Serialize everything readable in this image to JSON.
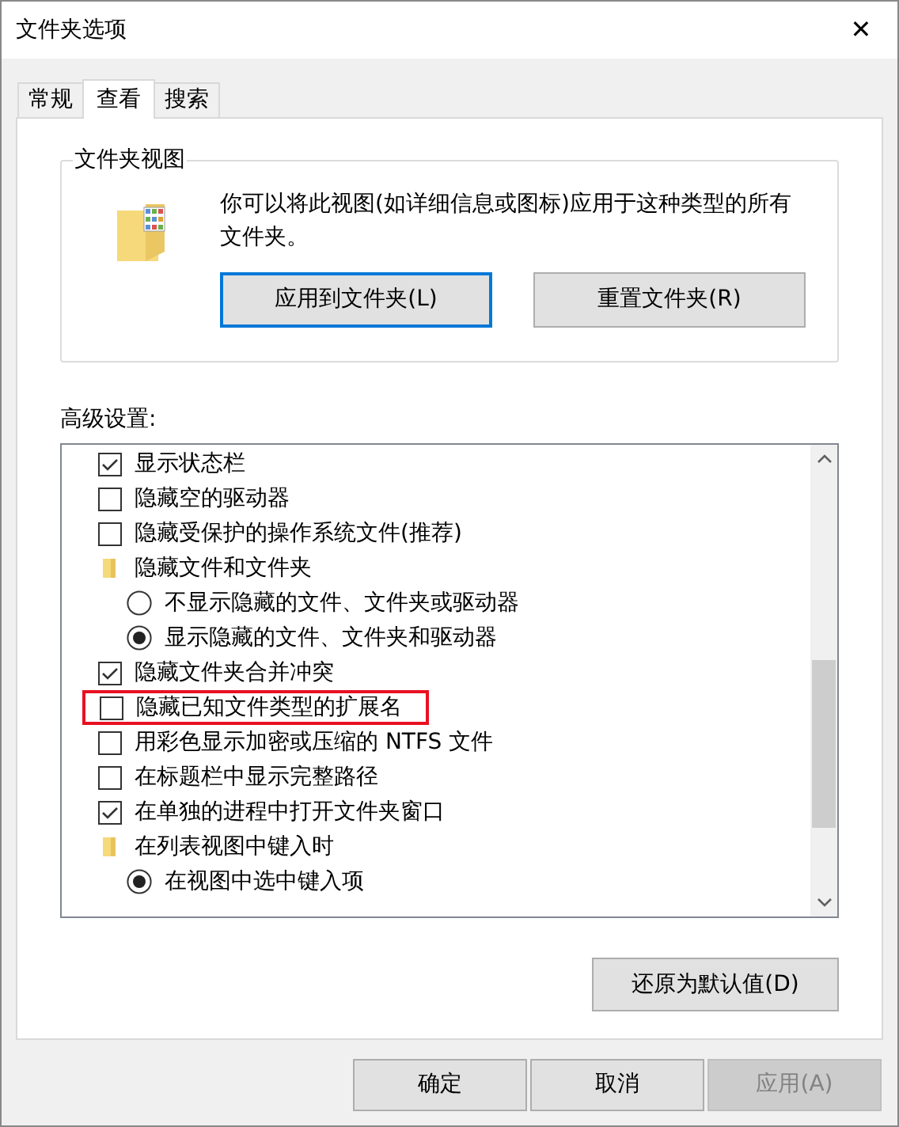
{
  "window": {
    "title": "文件夹选项",
    "close": "✕"
  },
  "tabs": [
    {
      "label": "常规",
      "selected": false
    },
    {
      "label": "查看",
      "selected": true
    },
    {
      "label": "搜索",
      "selected": false
    }
  ],
  "folder_views": {
    "title": "文件夹视图",
    "description": "你可以将此视图(如详细信息或图标)应用于这种类型的所有文件夹。",
    "buttons": [
      {
        "label": "应用到文件夹(L)",
        "focused": true
      },
      {
        "label": "重置文件夹(R)",
        "focused": false
      }
    ]
  },
  "advanced": {
    "label": "高级设置:",
    "items": [
      {
        "kind": "checkbox",
        "label": "显示状态栏",
        "checked": true,
        "highlighted": false
      },
      {
        "kind": "checkbox",
        "label": "隐藏空的驱动器",
        "checked": false,
        "highlighted": false
      },
      {
        "kind": "checkbox",
        "label": "隐藏受保护的操作系统文件(推荐)",
        "checked": false,
        "highlighted": false
      },
      {
        "kind": "folder",
        "label": "隐藏文件和文件夹",
        "children": [
          {
            "kind": "radio",
            "label": "不显示隐藏的文件、文件夹或驱动器",
            "selected": false
          },
          {
            "kind": "radio",
            "label": "显示隐藏的文件、文件夹和驱动器",
            "selected": true
          }
        ]
      },
      {
        "kind": "checkbox",
        "label": "隐藏文件夹合并冲突",
        "checked": true,
        "highlighted": false
      },
      {
        "kind": "checkbox",
        "label": "隐藏已知文件类型的扩展名",
        "checked": false,
        "highlighted": true
      },
      {
        "kind": "checkbox",
        "label": "用彩色显示加密或压缩的 NTFS 文件",
        "checked": false,
        "highlighted": false
      },
      {
        "kind": "checkbox",
        "label": "在标题栏中显示完整路径",
        "checked": false,
        "highlighted": false
      },
      {
        "kind": "checkbox",
        "label": "在单独的进程中打开文件夹窗口",
        "checked": true,
        "highlighted": false
      },
      {
        "kind": "folder",
        "label": "在列表视图中键入时",
        "children": [
          {
            "kind": "radio",
            "label": "在视图中选中键入项",
            "selected": true
          }
        ]
      }
    ],
    "restore_button": "还原为默认值(D)"
  },
  "footer_buttons": [
    {
      "label": "确定",
      "disabled": false
    },
    {
      "label": "取消",
      "disabled": false
    },
    {
      "label": "应用(A)",
      "disabled": true
    }
  ]
}
